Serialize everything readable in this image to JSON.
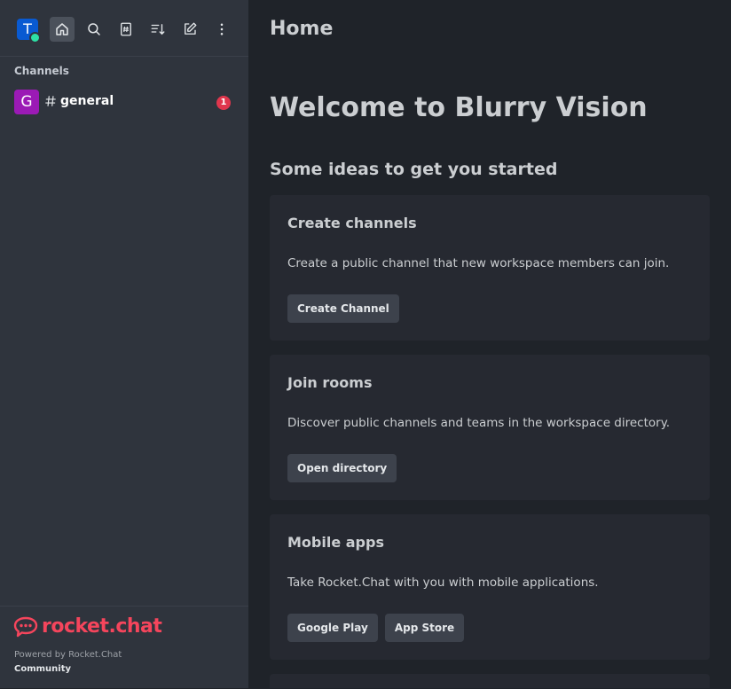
{
  "user": {
    "avatar_letter": "T"
  },
  "toolbar": {
    "icons": [
      "home-icon",
      "search-icon",
      "directory-icon",
      "sort-icon",
      "create-new-icon",
      "kebab-menu-icon"
    ]
  },
  "sidebar": {
    "section_label": "Channels",
    "rooms": [
      {
        "avatar_letter": "G",
        "name": "general",
        "unread": "1",
        "avatar_color": "#9b1ab5"
      }
    ]
  },
  "footer": {
    "logo_text": "rocket.chat",
    "powered_by": "Powered by Rocket.Chat",
    "edition": "Community"
  },
  "main": {
    "title": "Home",
    "welcome": "Welcome to Blurry Vision",
    "ideas_heading": "Some ideas to get you started",
    "cards": [
      {
        "title": "Create channels",
        "description": "Create a public channel that new workspace members can join.",
        "buttons": [
          "Create Channel"
        ]
      },
      {
        "title": "Join rooms",
        "description": "Discover public channels and teams in the workspace directory.",
        "buttons": [
          "Open directory"
        ]
      },
      {
        "title": "Mobile apps",
        "description": "Take Rocket.Chat with you with mobile applications.",
        "buttons": [
          "Google Play",
          "App Store"
        ]
      }
    ]
  },
  "colors": {
    "accent": "#f5455c",
    "badge": "#e0364d",
    "online": "#2de0a5"
  }
}
